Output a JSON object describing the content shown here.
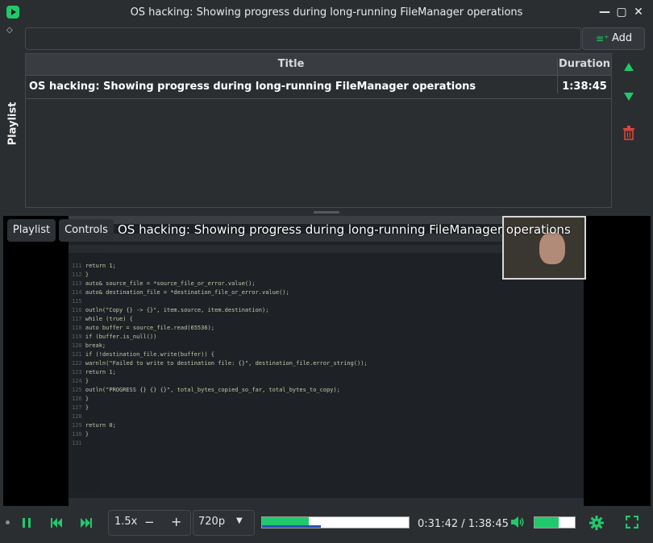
{
  "window": {
    "title": "OS hacking: Showing progress during long-running FileManager operations",
    "controls": {
      "minimize": "—",
      "maximize": "▢",
      "close": "✕"
    }
  },
  "sidebar": {
    "tab_label": "Playlist"
  },
  "search": {
    "value": "",
    "placeholder": ""
  },
  "add_button": {
    "label": "Add",
    "icon": "playlist-add-icon"
  },
  "playlist": {
    "columns": [
      "Title",
      "Duration"
    ],
    "rows": [
      {
        "title": "OS hacking: Showing progress during long-running FileManager operations",
        "duration": "1:38:45"
      }
    ]
  },
  "side_controls": {
    "up_icon": "triangle-up-icon",
    "down_icon": "triangle-down-icon",
    "delete_icon": "trash-icon"
  },
  "video": {
    "overlay_tabs": [
      "Playlist",
      "Controls"
    ],
    "overlay_title": "OS hacking: Showing progress during long-running FileManager operations",
    "code_lines": [
      {
        "n": "111",
        "t": "        return 1;"
      },
      {
        "n": "112",
        "t": "    }"
      },
      {
        "n": "113",
        "t": "    auto& source_file = *source_file_or_error.value();"
      },
      {
        "n": "114",
        "t": "    auto& destination_file = *destination_file_or_error.value();"
      },
      {
        "n": "115",
        "t": ""
      },
      {
        "n": "116",
        "t": "    outln(\"Copy {} -> {}\", item.source, item.destination);"
      },
      {
        "n": "117",
        "t": "    while (true) {"
      },
      {
        "n": "118",
        "t": "        auto buffer = source_file.read(65536);"
      },
      {
        "n": "119",
        "t": "        if (buffer.is_null())"
      },
      {
        "n": "120",
        "t": "            break;"
      },
      {
        "n": "121",
        "t": "        if (!destination_file.write(buffer)) {"
      },
      {
        "n": "122",
        "t": "            warnln(\"Failed to write to destination file: {}\", destination_file.error_string());"
      },
      {
        "n": "123",
        "t": "            return 1;"
      },
      {
        "n": "124",
        "t": "        }"
      },
      {
        "n": "125",
        "t": "        outln(\"PROGRESS {} {} {}\", total_bytes_copied_so_far, total_bytes_to_copy);"
      },
      {
        "n": "126",
        "t": "    }"
      },
      {
        "n": "127",
        "t": "}"
      },
      {
        "n": "128",
        "t": ""
      },
      {
        "n": "129",
        "t": "return 0;"
      },
      {
        "n": "130",
        "t": "}"
      },
      {
        "n": "131",
        "t": ""
      }
    ]
  },
  "controls": {
    "pause_icon": "pause-icon",
    "prev_icon": "skip-back-icon",
    "next_icon": "skip-forward-icon",
    "speed": "1.5x",
    "speed_minus": "−",
    "speed_plus": "+",
    "quality": "720p",
    "quality_arrow": "▼",
    "progress": 0.32,
    "buffered": 0.4,
    "time": "0:31:42 / 1:38:45",
    "volume": 0.6,
    "volume_icon": "speaker-icon",
    "settings_icon": "gear-icon",
    "fullscreen_icon": "fullscreen-icon"
  },
  "colors": {
    "accent": "#21c96b",
    "danger": "#e0443c",
    "background": "#2b2e31"
  }
}
